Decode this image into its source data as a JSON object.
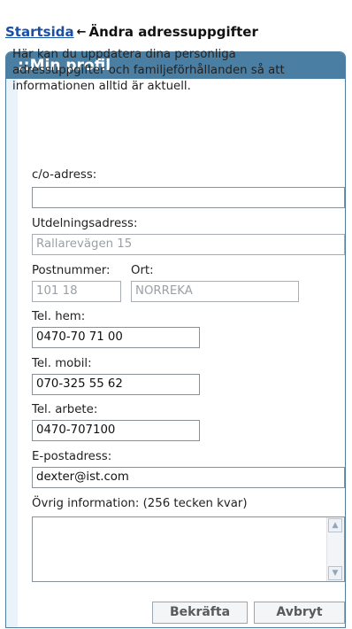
{
  "breadcrumb": {
    "home": "Startsida",
    "arrow": "←",
    "current": "Ändra adressuppgifter"
  },
  "panel": {
    "title": "::Min profil",
    "intro": "Här kan du uppdatera dina personliga adressuppgifter och familjeförhållanden så att informationen alltid är aktuell."
  },
  "form": {
    "co_label": "c/o-adress:",
    "co_value": "",
    "street_label": "Utdelningsadress:",
    "street_value": "Rallarevägen 15",
    "postnr_label": "Postnummer:",
    "ort_label": "Ort:",
    "postnr_value": "101 18",
    "ort_value": "NORREKA",
    "tel_hem_label": "Tel. hem:",
    "tel_hem_value": "0470-70 71 00",
    "tel_mobil_label": "Tel. mobil:",
    "tel_mobil_value": "070-325 55 62",
    "tel_arbete_label": "Tel. arbete:",
    "tel_arbete_value": "0470-707100",
    "email_label": "E-postadress:",
    "email_value": "dexter@ist.com",
    "other_label": "Övrig information: (256 tecken kvar)",
    "other_value": ""
  },
  "buttons": {
    "confirm": "Bekräfta",
    "cancel": "Avbryt"
  },
  "colors": {
    "header_bg": "#4a7fa3",
    "panel_bg": "#eaf3fb",
    "link": "#1a4fa6"
  }
}
